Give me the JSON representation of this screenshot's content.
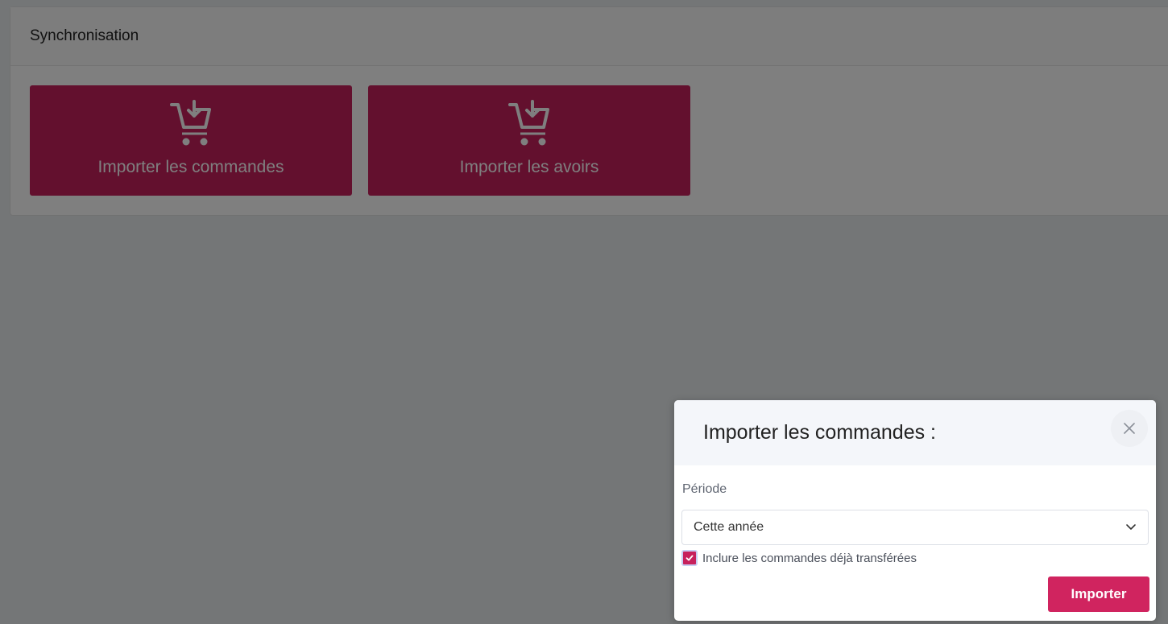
{
  "card": {
    "title": "Synchronisation",
    "tiles": [
      {
        "label": "Importer les commandes",
        "icon": "cart-download-icon"
      },
      {
        "label": "Importer les avoirs",
        "icon": "cart-download-icon"
      }
    ]
  },
  "modal": {
    "title": "Importer les commandes :",
    "close_icon": "close-icon",
    "period_label": "Période",
    "period_value": "Cette année",
    "include_label": "Inclure les commandes déjà transférées",
    "include_checked": true,
    "submit_label": "Importer"
  },
  "colors": {
    "accent": "#c7215d",
    "button": "#d0245f",
    "overlay": "rgba(0,0,0,0.5)"
  }
}
